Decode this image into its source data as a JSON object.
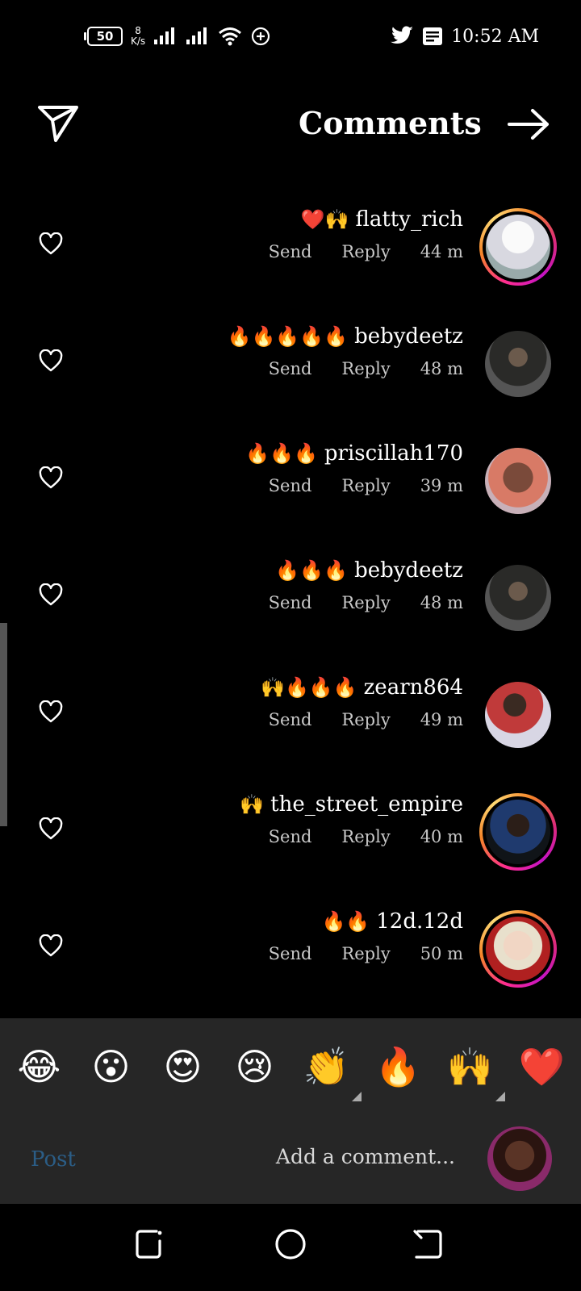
{
  "status_bar": {
    "battery_level": "50",
    "net_speed_value": "8",
    "net_speed_unit": "K/s",
    "time": "10:52 AM",
    "icons": [
      "signal-icon",
      "signal-icon",
      "wifi-icon",
      "data-saver-icon",
      "twitter-icon",
      "notification-icon"
    ]
  },
  "header": {
    "title": "Comments",
    "left_icon": "send-icon",
    "right_icon": "arrow-right-icon"
  },
  "comments": [
    {
      "emoji": "❤️🙌",
      "username": "flatty_rich",
      "send": "Send",
      "reply": "Reply",
      "time": "44 m",
      "story_ring": true,
      "avatar_color": "#e9e9ef"
    },
    {
      "emoji": "🔥🔥🔥🔥🔥",
      "username": "bebydeetz",
      "send": "Send",
      "reply": "Reply",
      "time": "48 m",
      "story_ring": false,
      "avatar_color": "#3b3b36"
    },
    {
      "emoji": "🔥🔥🔥",
      "username": "priscillah170",
      "send": "Send",
      "reply": "Reply",
      "time": "39 m",
      "story_ring": false,
      "avatar_color": "#b76a5d"
    },
    {
      "emoji": "🔥🔥🔥",
      "username": "bebydeetz",
      "send": "Send",
      "reply": "Reply",
      "time": "48 m",
      "story_ring": false,
      "avatar_color": "#3b3b36"
    },
    {
      "emoji": "🙌🔥🔥🔥",
      "username": "zearn864",
      "send": "Send",
      "reply": "Reply",
      "time": "49 m",
      "story_ring": false,
      "avatar_color": "#c9c6d8"
    },
    {
      "emoji": "🙌",
      "username": "the_street_empire",
      "send": "Send",
      "reply": "Reply",
      "time": "40 m",
      "story_ring": true,
      "avatar_color": "#1c2233"
    },
    {
      "emoji": "🔥🔥",
      "username": "12d.12d",
      "send": "Send",
      "reply": "Reply",
      "time": "50 m",
      "story_ring": true,
      "avatar_color": "#d9b8a0"
    }
  ],
  "reactions": [
    {
      "emoji": "😂",
      "has_more": false
    },
    {
      "emoji": "😮",
      "has_more": false
    },
    {
      "emoji": "😍",
      "has_more": false
    },
    {
      "emoji": "😢",
      "has_more": false
    },
    {
      "emoji": "👏",
      "has_more": true
    },
    {
      "emoji": "🔥",
      "has_more": false
    },
    {
      "emoji": "🙌",
      "has_more": true
    },
    {
      "emoji": "❤️",
      "has_more": false
    }
  ],
  "input": {
    "placeholder": "Add a comment...",
    "post_label": "Post"
  },
  "colors": {
    "background": "#000000",
    "panel": "#262626",
    "post_disabled": "#2b5d86",
    "meta_text": "#c8c8c8"
  }
}
